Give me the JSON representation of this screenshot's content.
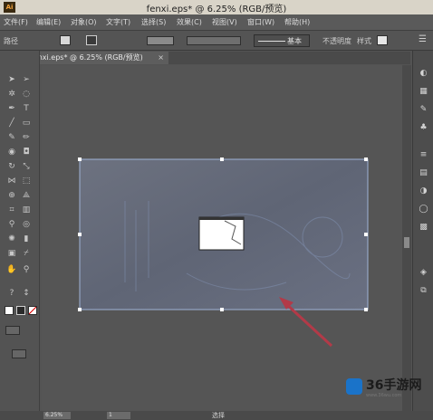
{
  "window": {
    "title": "fenxi.eps* @ 6.25% (RGB/预览)",
    "app_logo": "Ai"
  },
  "menu": [
    "文件(F)",
    "编辑(E)",
    "对象(O)",
    "文字(T)",
    "选择(S)",
    "效果(C)",
    "视图(V)",
    "窗口(W)",
    "帮助(H)"
  ],
  "options_bar": {
    "path_label": "路径",
    "stroke_label": "基本",
    "opacity_label": "不透明度",
    "style_label": "样式"
  },
  "document_tab": {
    "label": "fenxi.eps* @ 6.25% (RGB/预览)",
    "close": "×"
  },
  "status_bar": {
    "zoom": "6.25%",
    "page": "1",
    "mode": "选择"
  },
  "watermark": {
    "brand": "36手游网",
    "url": "www.36wu.com"
  },
  "colors": {
    "workspace": "#535353",
    "artboard": "#5e6166",
    "selection": "#9fb3d6",
    "arrow": "#b23a48"
  },
  "icons": {
    "toolbox": [
      "selection-arrow-icon",
      "direct-select-icon",
      "magic-wand-icon",
      "lasso-icon",
      "pen-icon",
      "type-icon",
      "line-icon",
      "rectangle-icon",
      "paintbrush-icon",
      "pencil-icon",
      "blob-brush-icon",
      "eraser-icon",
      "rotate-icon",
      "scale-icon",
      "width-icon",
      "free-transform-icon",
      "shape-builder-icon",
      "perspective-icon",
      "mesh-icon",
      "gradient-icon",
      "eyedropper-icon",
      "blend-icon",
      "symbol-sprayer-icon",
      "column-graph-icon",
      "artboard-icon",
      "slice-icon",
      "hand-icon",
      "zoom-icon"
    ],
    "panel": [
      "color-panel-icon",
      "swatches-icon",
      "brushes-icon",
      "symbols-icon",
      "stroke-icon",
      "gradient-panel-icon",
      "transparency-icon",
      "appearance-icon",
      "graphic-styles-icon",
      "layers-icon",
      "artboards-panel-icon"
    ]
  }
}
